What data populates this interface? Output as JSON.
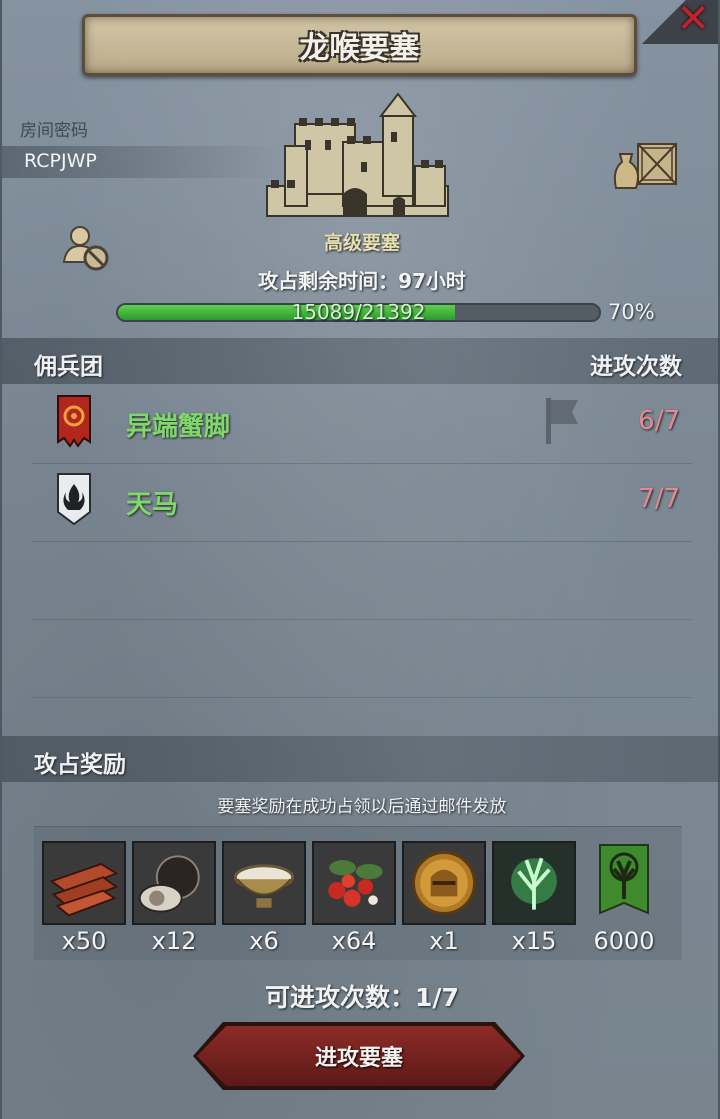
{
  "header": {
    "title": "龙喉要塞",
    "close_glyph": "✕"
  },
  "room": {
    "label": "房间密码",
    "code": "RCPJWP"
  },
  "fortress": {
    "level_label": "高级要塞",
    "time_label": "攻占剩余时间：97小时",
    "progress": {
      "current": 15089,
      "max": 21392,
      "text": "15089/21392",
      "percent_text": "70%",
      "fraction": 0.7
    }
  },
  "mercenary_section": {
    "left_label": "佣兵团",
    "right_label": "进攻次数"
  },
  "mercenaries": [
    {
      "name": "异端蟹脚",
      "count": "6/7",
      "badge_icon": "fire-eye-banner-icon"
    },
    {
      "name": "天马",
      "count": "7/7",
      "badge_icon": "flame-shield-banner-icon"
    }
  ],
  "reward_section": {
    "label": "攻占奖励",
    "note": "要塞奖励在成功占领以后通过邮件发放"
  },
  "rewards": [
    {
      "icon": "wood-planks-icon",
      "qty": "x50"
    },
    {
      "icon": "truffle-icon",
      "qty": "x12"
    },
    {
      "icon": "salt-bowl-icon",
      "qty": "x6"
    },
    {
      "icon": "berries-icon",
      "qty": "x64"
    },
    {
      "icon": "knight-helmet-coin-icon",
      "qty": "x1"
    },
    {
      "icon": "green-crystal-tree-icon",
      "qty": "x15"
    },
    {
      "icon": "tree-banner-icon",
      "qty": "6000"
    }
  ],
  "footer": {
    "attempts_label": "可进攻次数：1/7",
    "attack_button": "进攻要塞"
  },
  "colors": {
    "merc_name": "#7fd86a",
    "merc_count": "#e38a8f",
    "progress_fill": "#3fb53a",
    "close_red": "#c2232a",
    "button_red": "#7a2421"
  }
}
